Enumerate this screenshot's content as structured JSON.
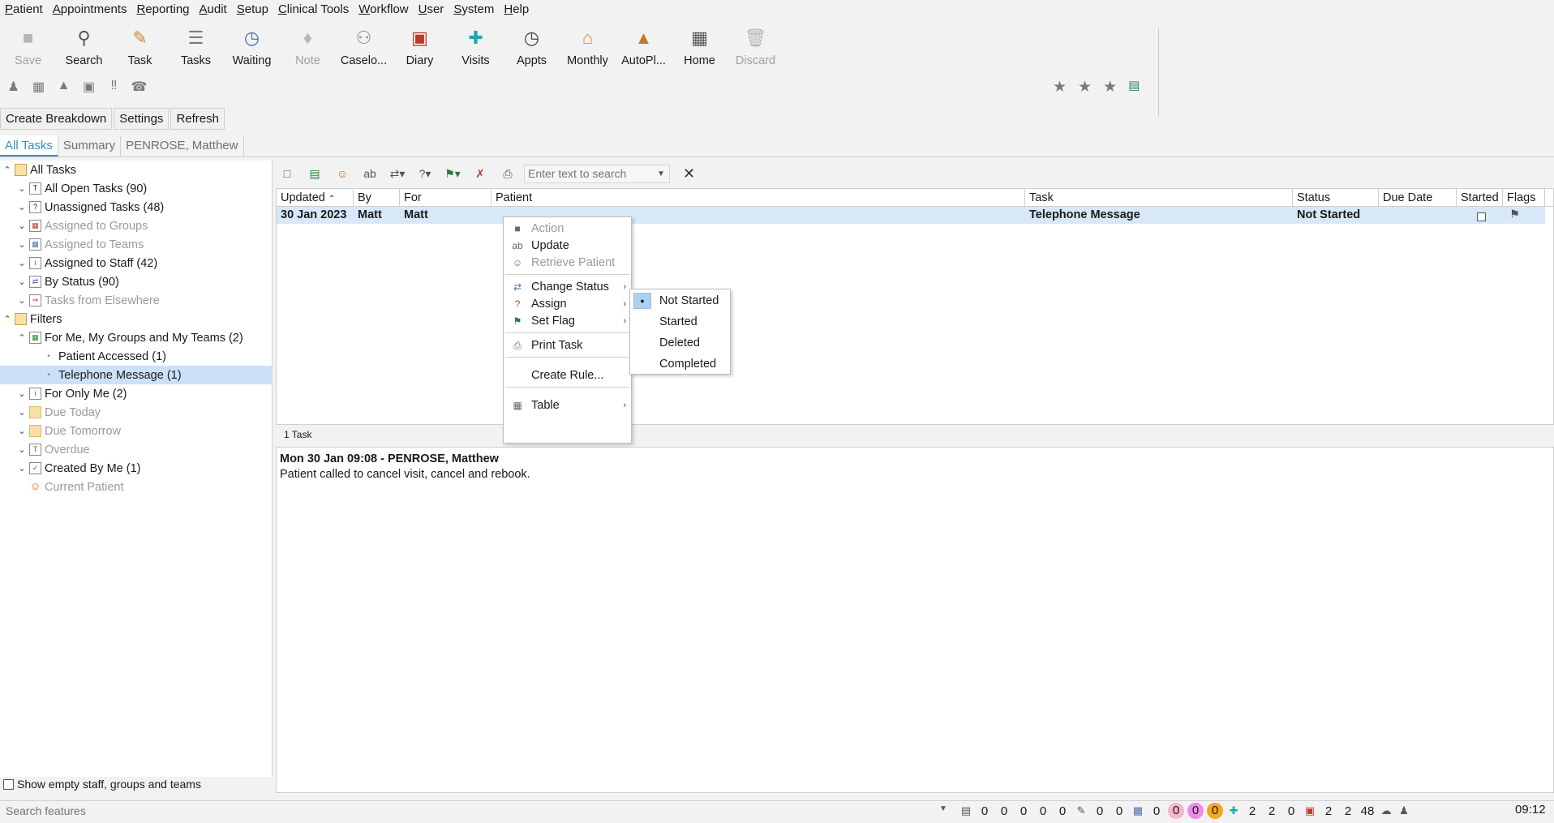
{
  "menu": [
    "Patient",
    "Appointments",
    "Reporting",
    "Audit",
    "Setup",
    "Clinical Tools",
    "Workflow",
    "User",
    "System",
    "Help"
  ],
  "toolbar": [
    {
      "label": "Save",
      "icon": "save-icon",
      "disabled": true
    },
    {
      "label": "Search",
      "icon": "search-icon",
      "disabled": false
    },
    {
      "label": "Task",
      "icon": "task-icon",
      "disabled": false
    },
    {
      "label": "Tasks",
      "icon": "tasks-icon",
      "disabled": false
    },
    {
      "label": "Waiting",
      "icon": "waiting-icon",
      "disabled": false
    },
    {
      "label": "Note",
      "icon": "note-icon",
      "disabled": true
    },
    {
      "label": "Caselo...",
      "icon": "caseload-icon",
      "disabled": false
    },
    {
      "label": "Diary",
      "icon": "diary-icon",
      "disabled": false
    },
    {
      "label": "Visits",
      "icon": "visits-icon",
      "disabled": false
    },
    {
      "label": "Appts",
      "icon": "appts-icon",
      "disabled": false
    },
    {
      "label": "Monthly",
      "icon": "monthly-icon",
      "disabled": false
    },
    {
      "label": "AutoPl...",
      "icon": "autoplan-icon",
      "disabled": false
    },
    {
      "label": "Home",
      "icon": "home-icon",
      "disabled": false
    },
    {
      "label": "Discard",
      "icon": "discard-icon",
      "disabled": true
    }
  ],
  "actions": {
    "create_breakdown": "Create Breakdown",
    "settings": "Settings",
    "refresh": "Refresh"
  },
  "tabs": [
    "All Tasks",
    "Summary",
    "PENROSE, Matthew"
  ],
  "tree": {
    "all_tasks": "All Tasks",
    "all_open": "All Open Tasks (90)",
    "unassigned": "Unassigned Tasks (48)",
    "groups": "Assigned to Groups",
    "teams": "Assigned to Teams",
    "staff": "Assigned to Staff (42)",
    "by_status": "By Status (90)",
    "elsewhere": "Tasks from Elsewhere",
    "filters": "Filters",
    "for_me": "For Me, My Groups and My Teams (2)",
    "patient_accessed": "Patient Accessed (1)",
    "telephone": "Telephone Message (1)",
    "only_me": "For Only Me (2)",
    "due_today": "Due Today",
    "due_tomorrow": "Due Tomorrow",
    "overdue": "Overdue",
    "created_by_me": "Created By Me (1)",
    "current_patient": "Current Patient"
  },
  "show_empty": "Show empty staff, groups and teams",
  "search": {
    "placeholder": "Enter text to search"
  },
  "columns": [
    "Updated",
    "By",
    "For",
    "Patient",
    "Task",
    "Status",
    "Due Date",
    "Started",
    "Flags"
  ],
  "row": {
    "updated": "30 Jan 2023",
    "by": "Matt",
    "for": "Matt",
    "patient": "",
    "task": "Telephone Message",
    "status": "Not Started",
    "due": ""
  },
  "count": "1 Task",
  "detail": {
    "header": "Mon 30 Jan 09:08 - PENROSE, Matthew",
    "body": "Patient called to cancel visit, cancel and rebook."
  },
  "context_menu": {
    "action": "Action",
    "update": "Update",
    "retrieve": "Retrieve Patient",
    "change_status": "Change Status",
    "assign": "Assign",
    "set_flag": "Set Flag",
    "print": "Print Task",
    "create_rule": "Create Rule...",
    "table": "Table"
  },
  "status_submenu": [
    "Not Started",
    "Started",
    "Deleted",
    "Completed"
  ],
  "status_selected": "Not Started",
  "statusbar": {
    "search_placeholder": "Search features",
    "counts_a": [
      "0",
      "0",
      "0",
      "0",
      "0"
    ],
    "counts_b": [
      "0",
      "0"
    ],
    "counts_c": [
      "0"
    ],
    "pills": [
      "0",
      "0",
      "0"
    ],
    "counts_d": [
      "2",
      "2",
      "0"
    ],
    "counts_e": [
      "2",
      "2",
      "48"
    ],
    "time": "09:12"
  },
  "colors": {
    "accent": "#2f8fcf",
    "selection": "#cce0f7",
    "row_selection": "#d8e8f8",
    "pill_pink": "#f7b6c8",
    "pill_magenta": "#f08ae8",
    "pill_orange": "#f5a623"
  }
}
